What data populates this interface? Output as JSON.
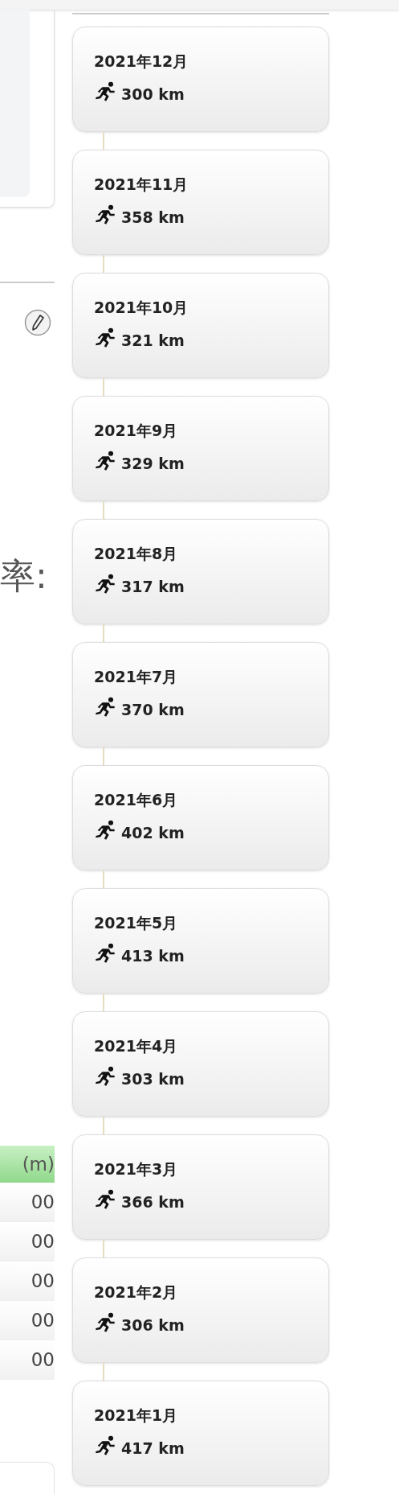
{
  "left": {
    "label": "率:",
    "table": {
      "header": "(m)",
      "rows": [
        "00",
        "00",
        "00",
        "00",
        "00"
      ]
    }
  },
  "months": [
    {
      "month": "2021年12月",
      "distance": "300 km"
    },
    {
      "month": "2021年11月",
      "distance": "358 km"
    },
    {
      "month": "2021年10月",
      "distance": "321 km"
    },
    {
      "month": "2021年9月",
      "distance": "329 km"
    },
    {
      "month": "2021年8月",
      "distance": "317 km"
    },
    {
      "month": "2021年7月",
      "distance": "370 km"
    },
    {
      "month": "2021年6月",
      "distance": "402 km"
    },
    {
      "month": "2021年5月",
      "distance": "413 km"
    },
    {
      "month": "2021年4月",
      "distance": "303 km"
    },
    {
      "month": "2021年3月",
      "distance": "366 km"
    },
    {
      "month": "2021年2月",
      "distance": "306 km"
    },
    {
      "month": "2021年1月",
      "distance": "417 km"
    }
  ]
}
